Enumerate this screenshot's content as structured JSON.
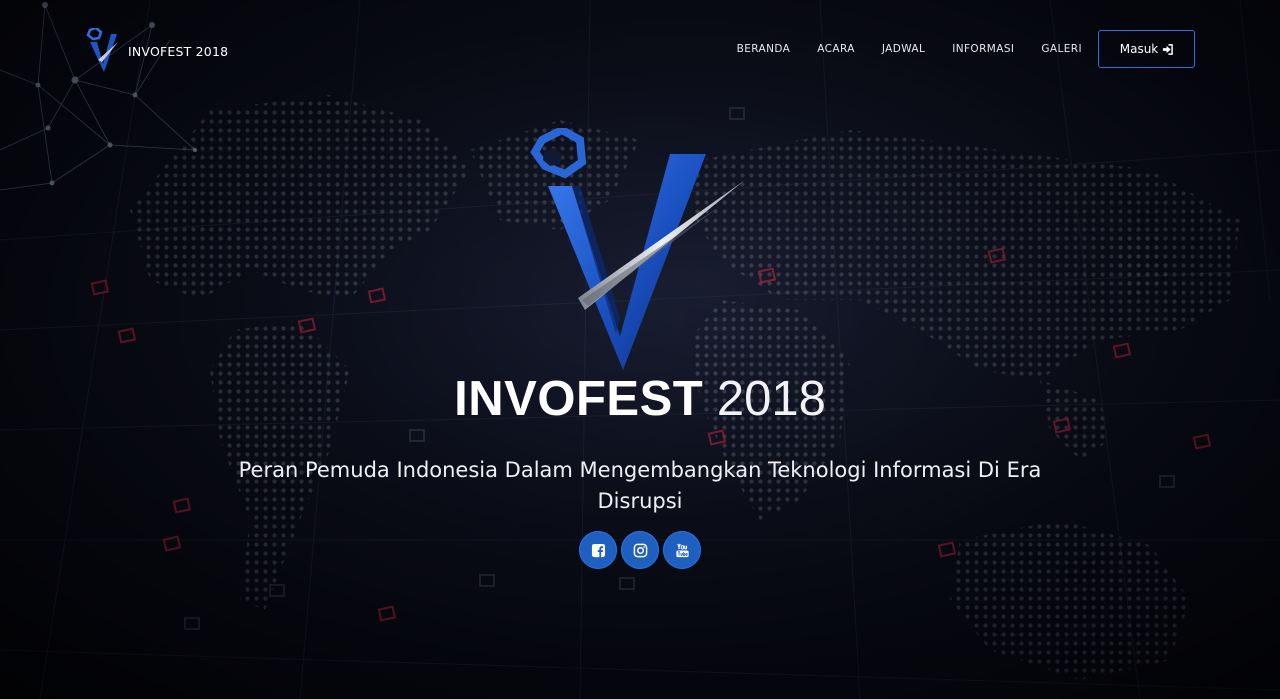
{
  "brand": {
    "name": "INVOFEST 2018"
  },
  "nav": {
    "items": [
      {
        "label": "BERANDA"
      },
      {
        "label": "ACARA"
      },
      {
        "label": "JADWAL"
      },
      {
        "label": "INFORMASI"
      },
      {
        "label": "GALERI"
      }
    ],
    "login_label": "Masuk",
    "login_icon": "sign-in-icon"
  },
  "hero": {
    "title_bold": "INVOFEST",
    "title_light": "2018",
    "subtitle": "Peran Pemuda Indonesia Dalam Mengembangkan Teknologi Informasi Di Era Disrupsi"
  },
  "socials": [
    {
      "icon": "facebook-icon"
    },
    {
      "icon": "instagram-icon"
    },
    {
      "icon": "youtube-icon"
    }
  ],
  "colors": {
    "accent": "#1f5fbf",
    "button_border": "#2b6fe6",
    "background": "#0b0d18"
  }
}
